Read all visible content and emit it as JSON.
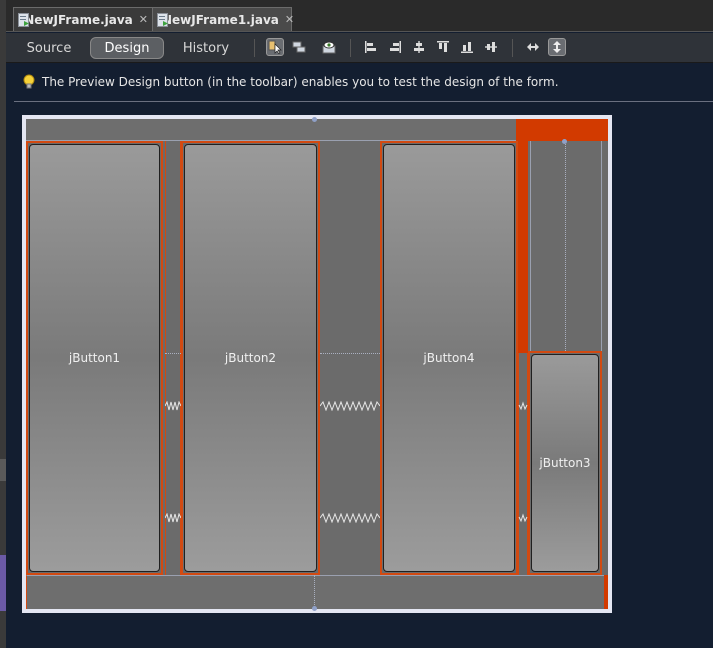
{
  "tabs": [
    {
      "label": "NewJFrame.java",
      "active": false
    },
    {
      "label": "NewJFrame1.java",
      "active": true
    }
  ],
  "toolbar": {
    "modes": [
      {
        "label": "Source",
        "active": false
      },
      {
        "label": "Design",
        "active": true
      },
      {
        "label": "History",
        "active": false
      }
    ],
    "icons": [
      "selection-mode-icon",
      "connection-mode-icon",
      "preview-design-icon",
      "align-left-icon",
      "align-right-icon",
      "center-horizontally-icon",
      "align-top-icon",
      "align-bottom-icon",
      "center-vertically-icon",
      "resize-horizontal-icon",
      "resize-vertical-icon"
    ]
  },
  "hint": {
    "text": "The Preview Design button (in the toolbar) enables you to test the design of the form."
  },
  "form": {
    "buttons": [
      {
        "label": "jButton1"
      },
      {
        "label": "jButton2"
      },
      {
        "label": "jButton4"
      },
      {
        "label": "jButton3"
      }
    ],
    "colors": {
      "selection": "#d24a12",
      "background": "#6b6b6b",
      "outer": "#e4e6f2"
    }
  }
}
